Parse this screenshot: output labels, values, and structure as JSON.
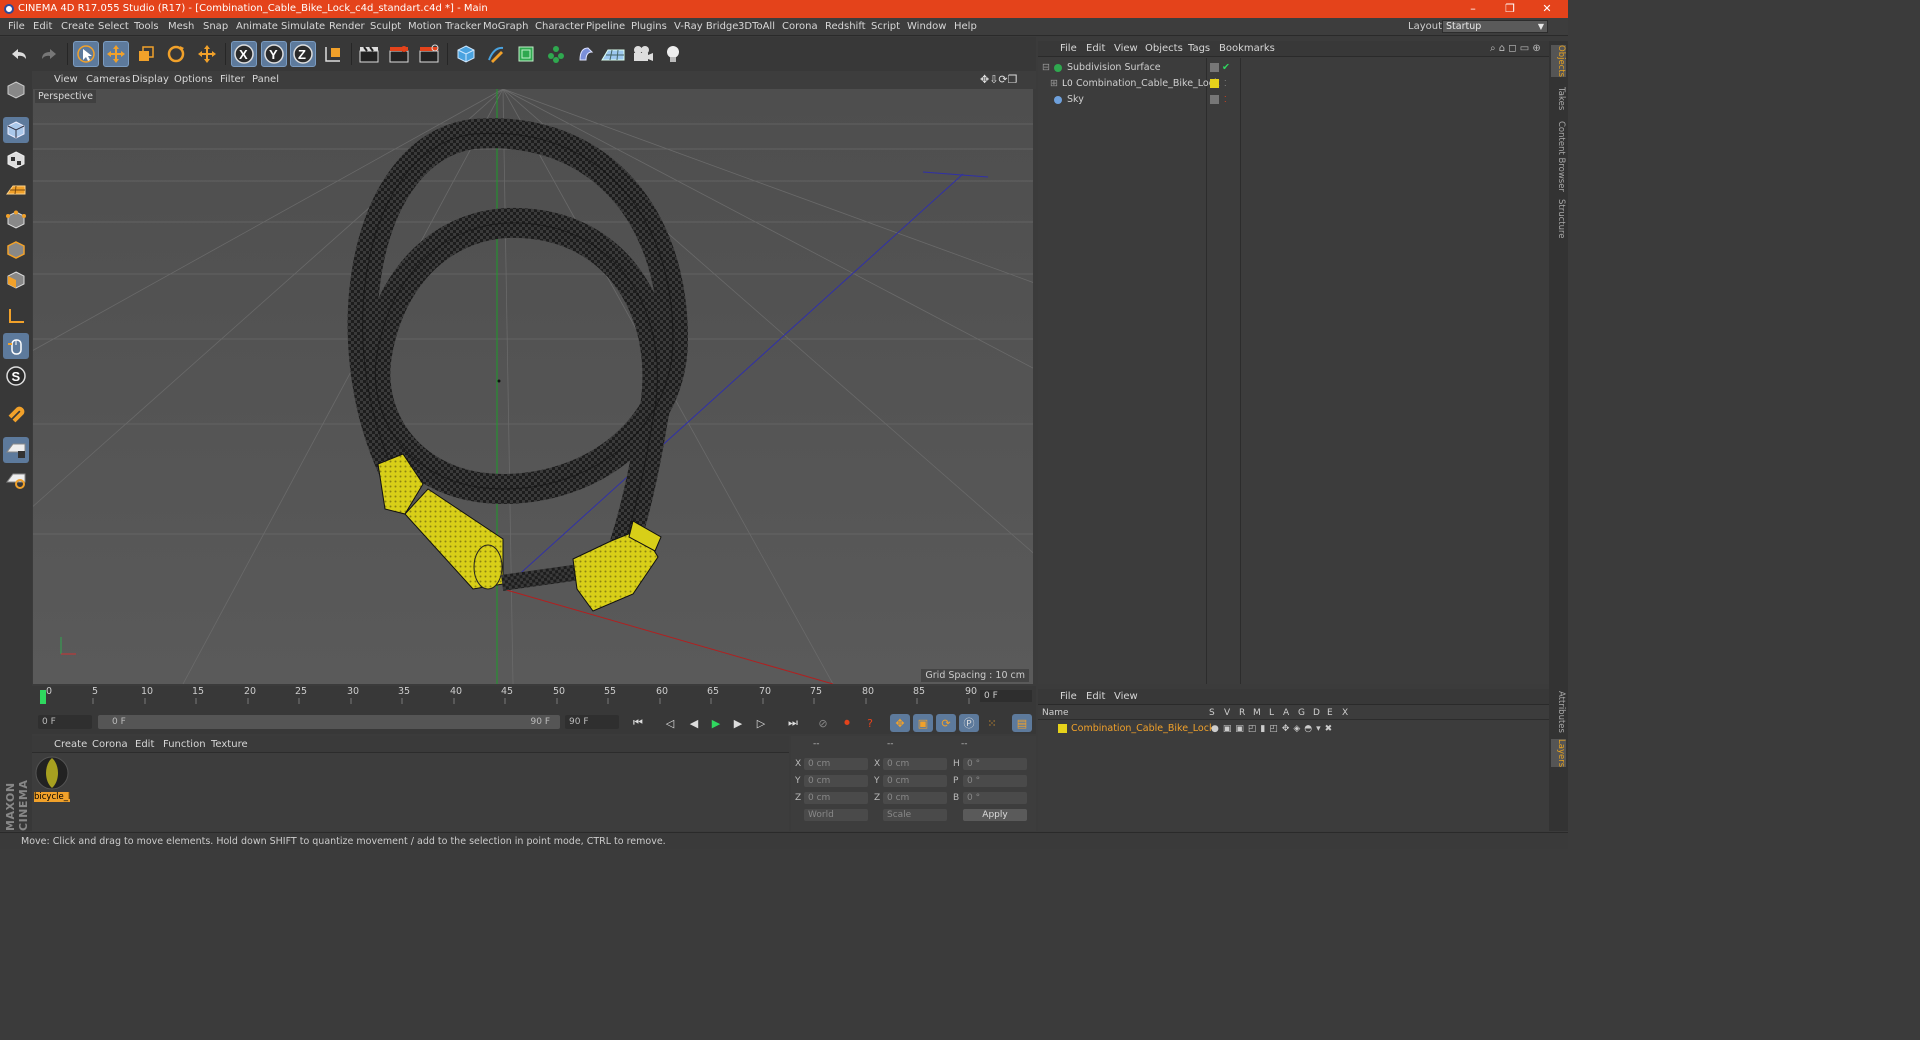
{
  "titlebar": {
    "title": "CINEMA 4D R17.055 Studio (R17) - [Combination_Cable_Bike_Lock_c4d_standart.c4d *] - Main",
    "minimize": "–",
    "restore": "❐",
    "close": "✕"
  },
  "menubar": {
    "items": [
      "File",
      "Edit",
      "Create",
      "Select",
      "Tools",
      "Mesh",
      "Snap",
      "Animate",
      "Simulate",
      "Render",
      "Sculpt",
      "Motion Tracker",
      "MoGraph",
      "Character",
      "Pipeline",
      "Plugins",
      "V-Ray Bridge",
      "3DToAll",
      "Corona",
      "Redshift",
      "Script",
      "Window",
      "Help"
    ],
    "layout_label": "Layout:",
    "layout_value": "Startup"
  },
  "viewport": {
    "menu": [
      "View",
      "Cameras",
      "Display",
      "Options",
      "Filter",
      "Panel"
    ],
    "label": "Perspective",
    "grid_spacing": "Grid Spacing : 10 cm"
  },
  "timeline": {
    "ticks": [
      "0",
      "5",
      "10",
      "15",
      "20",
      "25",
      "30",
      "35",
      "40",
      "45",
      "50",
      "55",
      "60",
      "65",
      "70",
      "75",
      "80",
      "85",
      "90"
    ],
    "current_frame": "0 F",
    "start_field": "0 F",
    "range_start": "0 F",
    "range_end": "90 F",
    "end_field": "90 F"
  },
  "material_panel": {
    "menu": [
      "Create",
      "Corona",
      "Edit",
      "Function",
      "Texture"
    ],
    "material_name": "bicycle_l"
  },
  "coords": {
    "headers": [
      "--",
      "--",
      "--"
    ],
    "rows": [
      {
        "a": "X",
        "av": "0 cm",
        "b": "X",
        "bv": "0 cm",
        "c": "H",
        "cv": "0 °"
      },
      {
        "a": "Y",
        "av": "0 cm",
        "b": "Y",
        "bv": "0 cm",
        "c": "P",
        "cv": "0 °"
      },
      {
        "a": "Z",
        "av": "0 cm",
        "b": "Z",
        "bv": "0 cm",
        "c": "B",
        "cv": "0 °"
      }
    ],
    "mode1": "World",
    "mode2": "Scale",
    "apply": "Apply"
  },
  "object_manager": {
    "menu": [
      "File",
      "Edit",
      "View",
      "Objects",
      "Tags",
      "Bookmarks"
    ],
    "objects": [
      "Subdivision Surface",
      "Combination_Cable_Bike_Lock",
      "Sky"
    ]
  },
  "layer_manager": {
    "menu": [
      "File",
      "Edit",
      "View"
    ],
    "name_header": "Name",
    "columns": [
      "S",
      "V",
      "R",
      "M",
      "L",
      "A",
      "G",
      "D",
      "E",
      "X"
    ],
    "layer": "Combination_Cable_Bike_Lock"
  },
  "right_tabs": [
    "Objects",
    "Takes",
    "Content Browser",
    "Structure",
    "Attributes",
    "Layers"
  ],
  "status": "Move: Click and drag to move elements. Hold down SHIFT to quantize movement / add to the selection in point mode, CTRL to remove.",
  "brand": "MAXON CINEMA 4D",
  "colors": {
    "accent": "#e4431b",
    "layer_yellow": "#e6d21a",
    "selection_blue": "#5d7a9c"
  }
}
